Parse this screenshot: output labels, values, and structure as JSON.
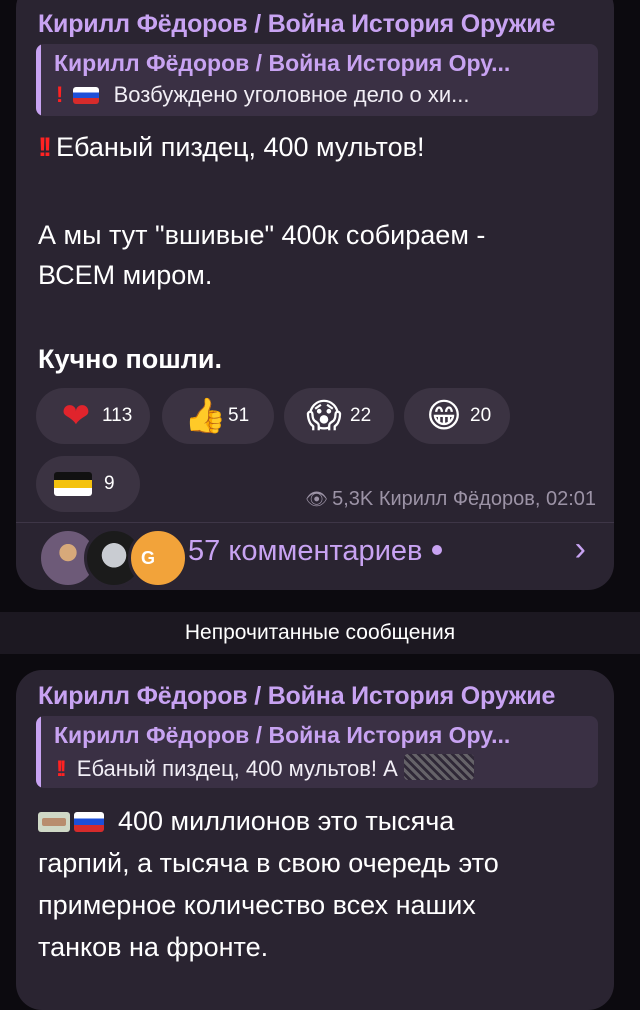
{
  "message1": {
    "author": "Кирилл Фёдоров / Война История Оружие",
    "reply": {
      "author": "Кирилл Фёдоров / Война История Ору...",
      "text": "Возбуждено уголовное дело о хи..."
    },
    "lines": [
      "Ебаный пиздец, 400 мультов!",
      "А мы тут \"вшивые\" 400к собираем -",
      "ВСЕМ миром.",
      "Кучно пошли."
    ],
    "reactions": [
      {
        "icon": "heart-icon",
        "glyph": "❤",
        "count": "113"
      },
      {
        "icon": "thumbs-up-icon",
        "glyph": "👍",
        "count": "51"
      },
      {
        "icon": "scream-face-icon",
        "glyph": "😱",
        "count": "22"
      },
      {
        "icon": "grin-face-icon",
        "glyph": "😁",
        "count": "20"
      },
      {
        "icon": "imperial-flag-icon",
        "glyph": "",
        "count": "9"
      }
    ],
    "meta": "5,3K Кирилл Фёдоров, 02:01",
    "comments_label": "57 комментариев",
    "avatar_letter": "G"
  },
  "unread_label": "Непрочитанные сообщения",
  "message2": {
    "author": "Кирилл Фёдоров / Война История Оружие",
    "reply": {
      "author": "Кирилл Фёдоров / Война История Ору...",
      "text": "Ебаный пиздец, 400 мультов! А"
    },
    "lines": [
      "400 миллионов это тысяча",
      "гарпий, а тысяча в свою очередь это",
      "примерное количество всех наших",
      "танков на фронте."
    ]
  },
  "colors": {
    "accent": "#c8a3f2",
    "bubble": "#2a2431",
    "background": "#0c0a0f"
  }
}
